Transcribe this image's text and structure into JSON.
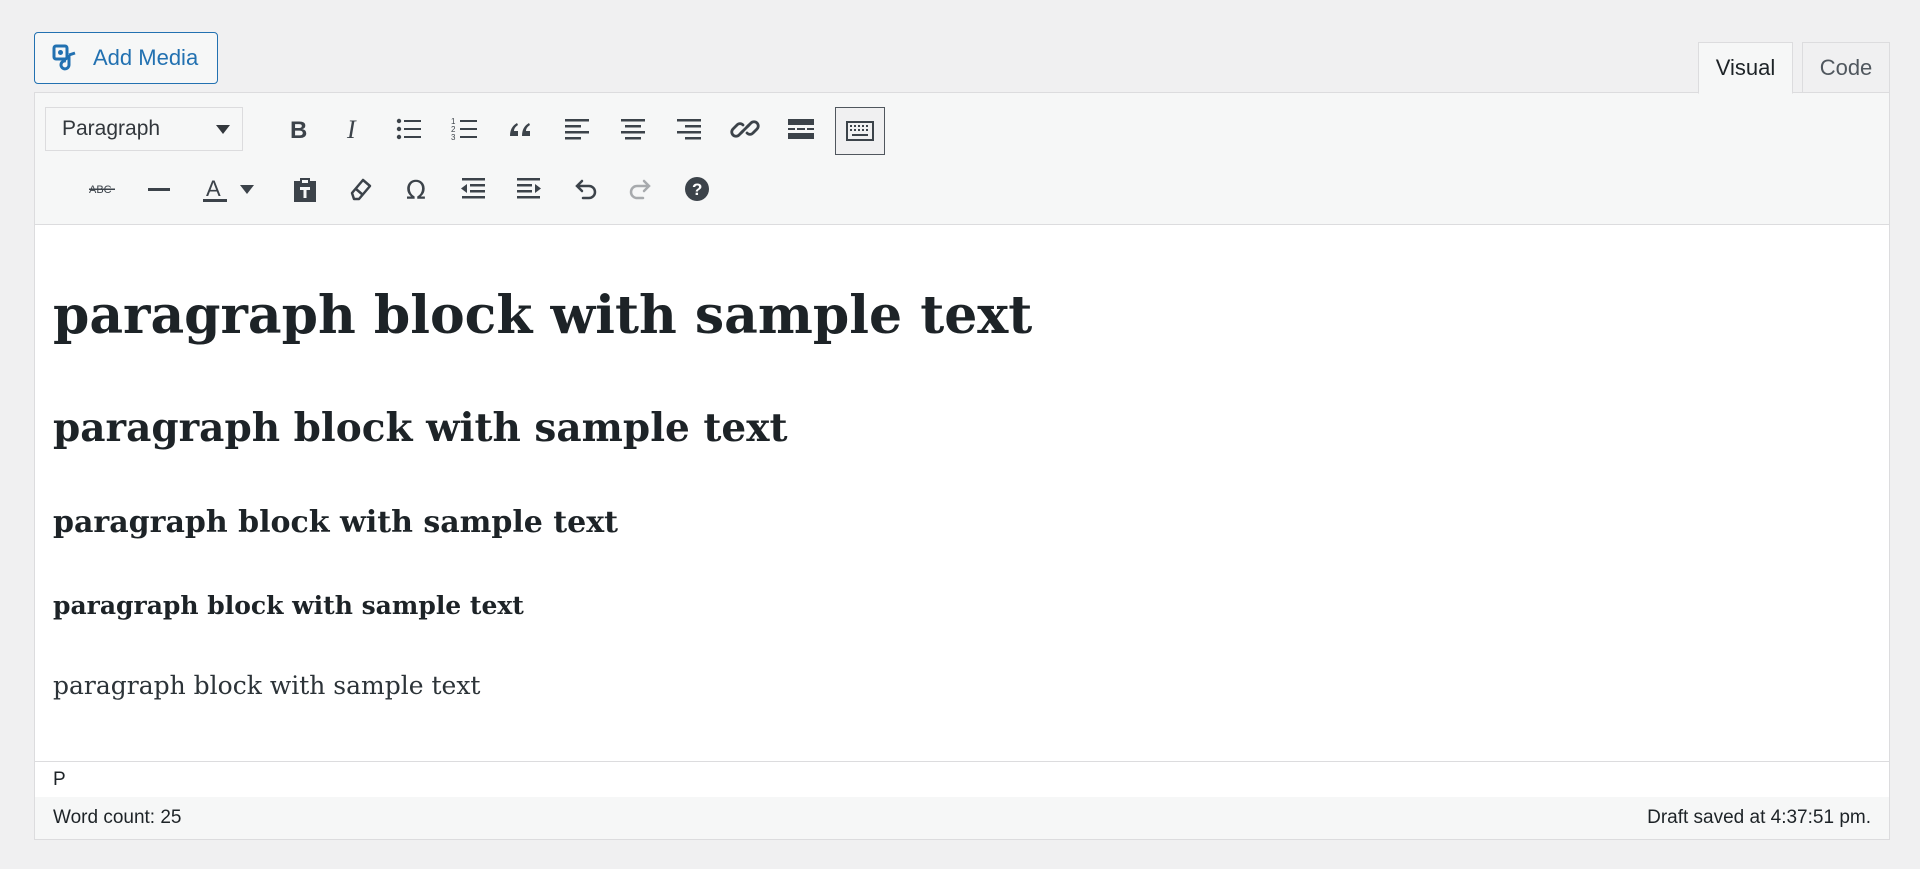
{
  "add_media": {
    "label": "Add Media"
  },
  "tabs": [
    {
      "label": "Visual"
    },
    {
      "label": "Code"
    }
  ],
  "toolbar": {
    "format_select": {
      "value": "Paragraph"
    },
    "row1": [
      "bold-icon",
      "italic-icon",
      "bulleted-list-icon",
      "numbered-list-icon",
      "blockquote-icon",
      "align-left-icon",
      "align-center-icon",
      "align-right-icon",
      "link-icon",
      "read-more-icon",
      "toolbar-toggle-icon"
    ],
    "row2": [
      "strikethrough-icon",
      "horizontal-line-icon",
      "text-color-icon",
      "paste-as-text-icon",
      "clear-formatting-icon",
      "special-character-icon",
      "outdent-icon",
      "indent-icon",
      "undo-icon",
      "redo-icon",
      "help-icon"
    ],
    "strikethrough_glyph": "ABC",
    "text_color_glyph": "A",
    "special_char_glyph": "Ω",
    "help_glyph": "?"
  },
  "content": {
    "h1": "paragraph block with sample text",
    "h2": "paragraph block with sample text",
    "h3": "paragraph block with sample text",
    "h4": "paragraph block with sample text",
    "p": "paragraph block with sample text"
  },
  "path": "P",
  "status": {
    "word_count": "Word count: 25",
    "draft_saved": "Draft saved at 4:37:51 pm."
  },
  "colors": {
    "accent": "#2271b1",
    "icon": "#3c434a",
    "disabled": "#a7aaad"
  }
}
